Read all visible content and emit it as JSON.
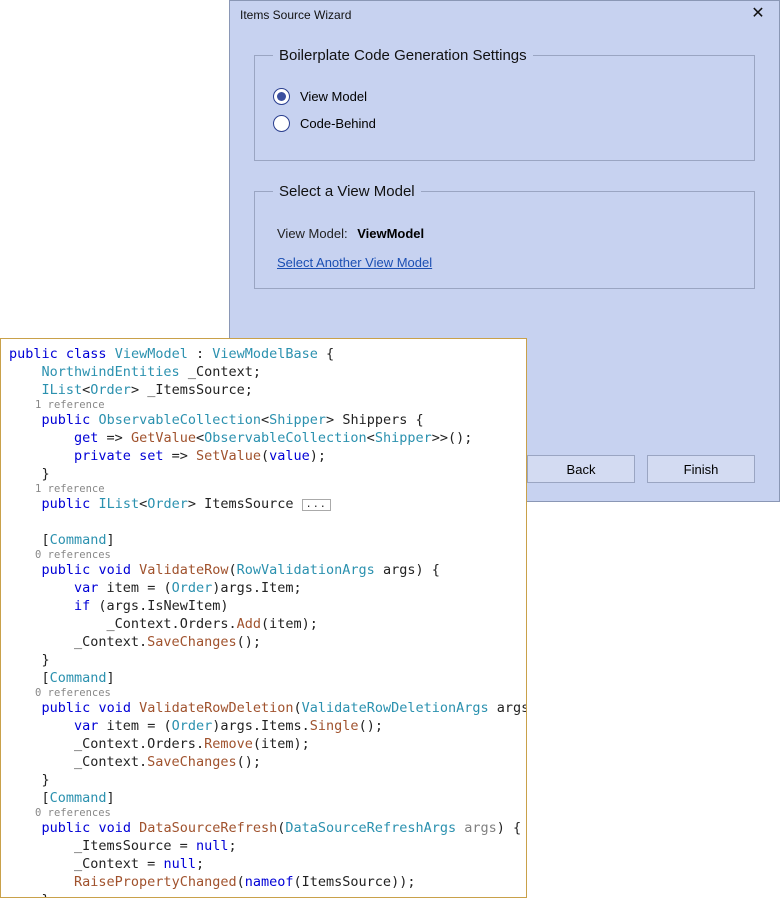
{
  "dialog": {
    "title": "Items Source Wizard",
    "boilerplate": {
      "legend": "Boilerplate Code Generation Settings",
      "option_viewmodel": "View Model",
      "option_codebehind": "Code-Behind"
    },
    "select_vm": {
      "legend": "Select a View Model",
      "label": "View Model:",
      "value": "ViewModel",
      "link": "Select Another View Model"
    },
    "buttons": {
      "back": "Back",
      "finish": "Finish"
    }
  },
  "code": {
    "ref1": "1 reference",
    "ref1b": "1 reference",
    "ref0a": "0 references",
    "ref0b": "0 references",
    "ref0c": "0 references",
    "class_name": "ViewModel",
    "base_class": "ViewModelBase",
    "ctx_type": "NorthwindEntities",
    "ctx_field": "_Context",
    "ilist": "IList",
    "order": "Order",
    "items_field": "_ItemsSource",
    "obs": "ObservableCollection",
    "shipper": "Shipper",
    "shippers_prop": "Shippers",
    "getvalue": "GetValue",
    "setvalue": "SetValue",
    "itemssource_prop": "ItemsSource",
    "command": "Command",
    "validaterow": "ValidateRow",
    "rowvargs": "RowValidationArgs",
    "validaterowdel": "ValidateRowDeletion",
    "rowdelargs": "ValidateRowDeletionArgs",
    "dsr": "DataSourceRefresh",
    "dsrargs": "DataSourceRefreshArgs",
    "add": "Add",
    "remove": "Remove",
    "save": "SaveChanges",
    "single": "Single",
    "isnew": "IsNewItem",
    "orders": "Orders",
    "item": "Item",
    "items": "Items",
    "rpc": "RaisePropertyChanged",
    "nameof": "nameof"
  }
}
